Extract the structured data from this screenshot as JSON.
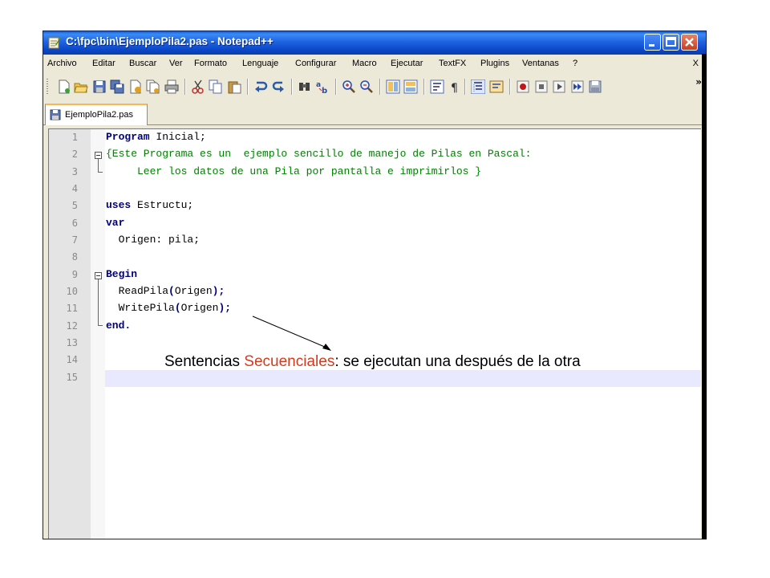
{
  "window": {
    "title": "C:\\fpc\\bin\\EjemploPila2.pas - Notepad++",
    "caption_buttons": [
      "minimize",
      "maximize",
      "close"
    ]
  },
  "menu": {
    "items": [
      "Archivo",
      "Editar",
      "Buscar",
      "Ver",
      "Formato",
      "Lenguaje",
      "Configurar",
      "Macro",
      "Ejecutar",
      "TextFX",
      "Plugins",
      "Ventanas",
      "?"
    ],
    "close": "X"
  },
  "toolbar": {
    "icons": [
      "new-file-icon",
      "open-file-icon",
      "save-icon",
      "save-all-icon",
      "close-file-icon",
      "close-all-icon",
      "print-icon",
      "cut-icon",
      "copy-icon",
      "paste-icon",
      "undo-icon",
      "redo-icon",
      "find-icon",
      "replace-icon",
      "zoom-in-icon",
      "zoom-out-icon",
      "sync-vertical-icon",
      "sync-horizontal-icon",
      "word-wrap-icon",
      "show-all-chars-icon",
      "indent-guide-icon",
      "user-lang-icon",
      "record-macro-icon",
      "stop-record-icon",
      "play-macro-icon",
      "run-macro-multiple-icon",
      "save-macro-icon"
    ],
    "more": "»"
  },
  "tab": {
    "label": "EjemploPila2.pas"
  },
  "editor": {
    "line_numbers": [
      "1",
      "2",
      "3",
      "4",
      "5",
      "6",
      "7",
      "8",
      "9",
      "10",
      "11",
      "12",
      "13",
      "14",
      "15"
    ],
    "lines": {
      "l1_kw": "Program",
      "l1_rest": " Inicial;",
      "l2": "{Este Programa es un  ejemplo sencillo de manejo de Pilas en Pascal:",
      "l3": "     Leer los datos de una Pila por pantalla e imprimirlos }",
      "l5_kw": "uses",
      "l5_rest": " Estructu;",
      "l6_kw": "var",
      "l7": "  Origen: pila;",
      "l9_kw": "Begin",
      "l10_a": "  ReadPila",
      "l10_b": "(",
      "l10_c": "Origen",
      "l10_d": ");",
      "l11_a": "  WritePila",
      "l11_b": "(",
      "l11_c": "Origen",
      "l11_d": ");",
      "l12_kw": "end."
    }
  },
  "annotation": {
    "part1": "Sentencias ",
    "highlight": "Secuenciales",
    "part2": ": se ejecutan una después de la otra",
    "highlight_color": "#d23b1e"
  }
}
